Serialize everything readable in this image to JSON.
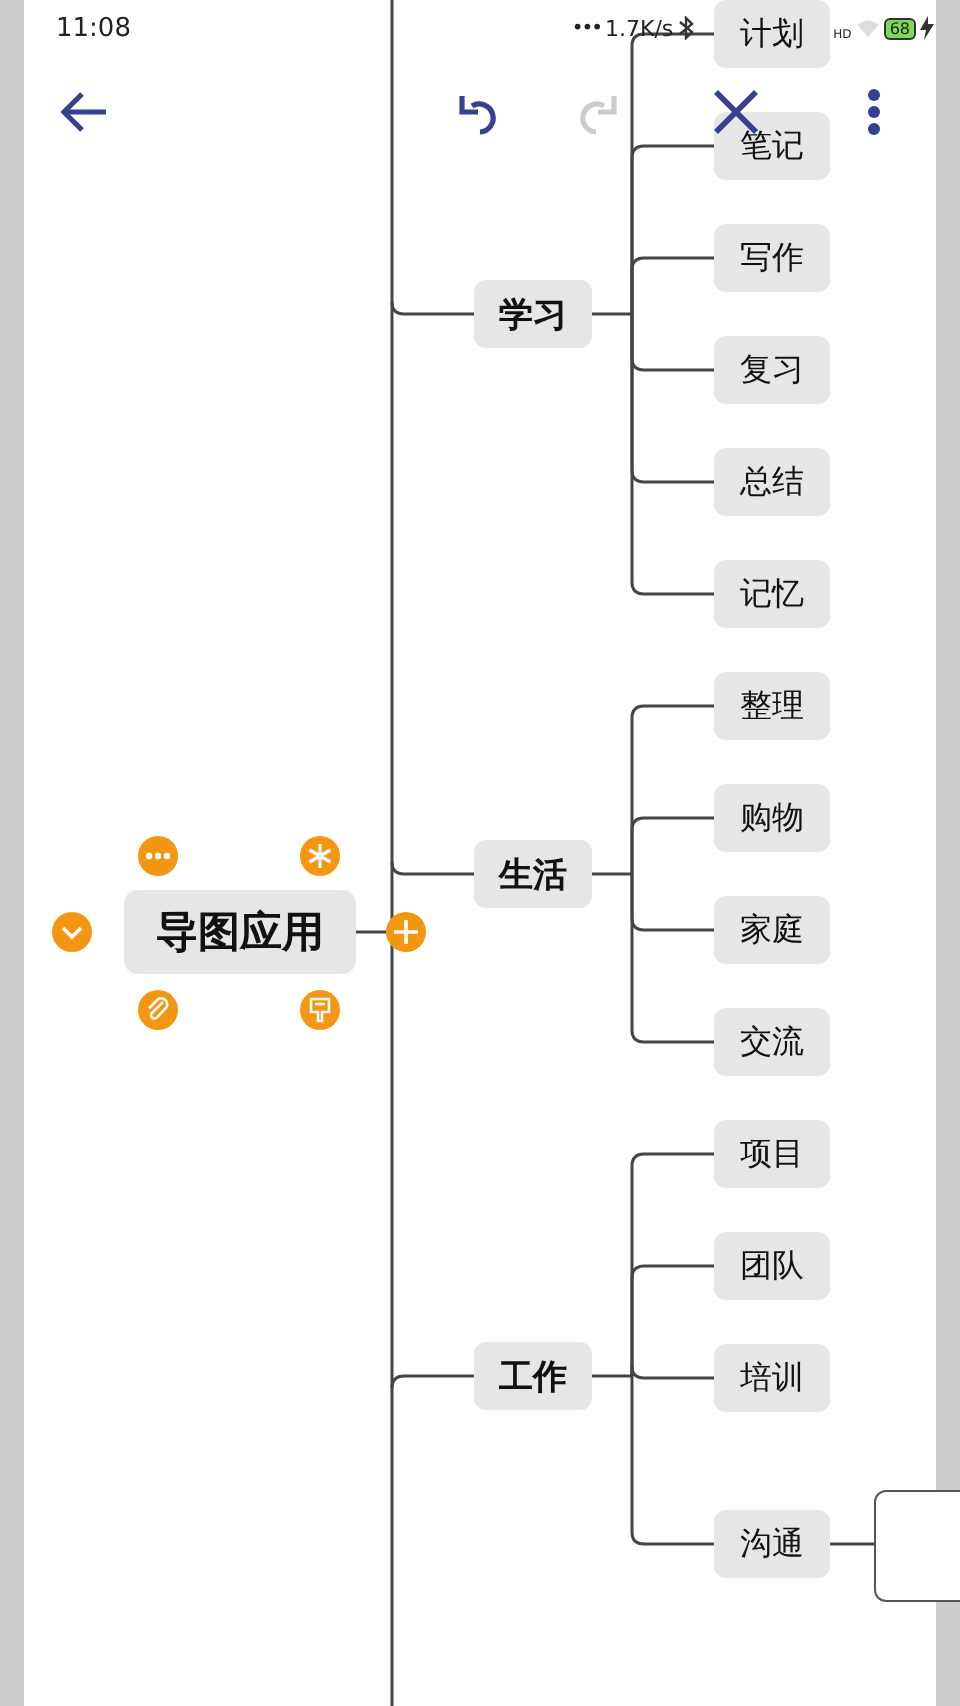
{
  "status_bar": {
    "time": "11:08",
    "dots": "•••",
    "speed": "1.7K/s",
    "network": "HD",
    "battery": "68"
  },
  "toolbar": [
    {
      "kind": "back",
      "disabled": false
    },
    {
      "kind": "undo",
      "disabled": false
    },
    {
      "kind": "redo",
      "disabled": true
    },
    {
      "kind": "close",
      "disabled": false
    },
    {
      "kind": "more",
      "disabled": false
    }
  ],
  "mind_map": {
    "root": {
      "label": "导图应用",
      "selected": true
    },
    "branches": [
      {
        "label": "学习",
        "children": [
          {
            "label": "计划"
          },
          {
            "label": "笔记"
          },
          {
            "label": "写作"
          },
          {
            "label": "复习"
          },
          {
            "label": "总结"
          },
          {
            "label": "记忆"
          }
        ]
      },
      {
        "label": "生活",
        "children": [
          {
            "label": "整理"
          },
          {
            "label": "购物"
          },
          {
            "label": "家庭"
          },
          {
            "label": "交流"
          }
        ]
      },
      {
        "label": "工作",
        "children": [
          {
            "label": "项目"
          },
          {
            "label": "团队"
          },
          {
            "label": "培训"
          },
          {
            "label": "沟通",
            "children": [
              {
                "kind": "node"
              }
            ]
          }
        ]
      }
    ]
  }
}
